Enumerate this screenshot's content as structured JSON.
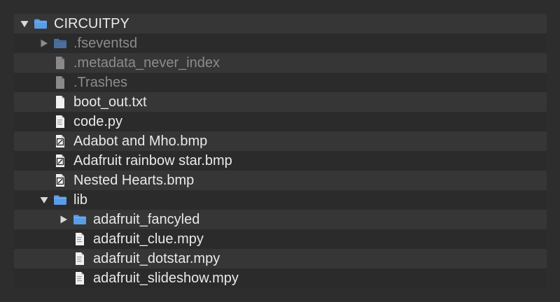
{
  "colors": {
    "background": "#2d2d2d",
    "row_alt": "#363636",
    "text": "#e9e9e9",
    "text_dim": "#8c8c8c",
    "folder_blue": "#5b9ce8",
    "folder_dim": "#4a6f9c"
  },
  "tree": [
    {
      "label": "CIRCUITPY",
      "type": "folder",
      "expanded": true,
      "level": 0,
      "dim": false,
      "icon": "folder-icon"
    },
    {
      "label": ".fseventsd",
      "type": "folder",
      "expanded": false,
      "level": 1,
      "dim": true,
      "icon": "folder-icon"
    },
    {
      "label": ".metadata_never_index",
      "type": "file",
      "level": 1,
      "dim": true,
      "icon": "document-icon"
    },
    {
      "label": ".Trashes",
      "type": "file",
      "level": 1,
      "dim": true,
      "icon": "document-icon"
    },
    {
      "label": "boot_out.txt",
      "type": "file",
      "level": 1,
      "dim": false,
      "icon": "document-icon"
    },
    {
      "label": "code.py",
      "type": "file",
      "level": 1,
      "dim": false,
      "icon": "script-file-icon"
    },
    {
      "label": "Adabot and Mho.bmp",
      "type": "file",
      "level": 1,
      "dim": false,
      "icon": "image-file-icon"
    },
    {
      "label": "Adafruit rainbow star.bmp",
      "type": "file",
      "level": 1,
      "dim": false,
      "icon": "image-file-icon"
    },
    {
      "label": "Nested Hearts.bmp",
      "type": "file",
      "level": 1,
      "dim": false,
      "icon": "image-file-icon"
    },
    {
      "label": "lib",
      "type": "folder",
      "expanded": true,
      "level": 1,
      "dim": false,
      "icon": "folder-icon"
    },
    {
      "label": "adafruit_fancyled",
      "type": "folder",
      "expanded": false,
      "level": 2,
      "dim": false,
      "icon": "folder-icon"
    },
    {
      "label": "adafruit_clue.mpy",
      "type": "file",
      "level": 2,
      "dim": false,
      "icon": "script-file-icon"
    },
    {
      "label": "adafruit_dotstar.mpy",
      "type": "file",
      "level": 2,
      "dim": false,
      "icon": "script-file-icon"
    },
    {
      "label": "adafruit_slideshow.mpy",
      "type": "file",
      "level": 2,
      "dim": false,
      "icon": "script-file-icon"
    }
  ]
}
